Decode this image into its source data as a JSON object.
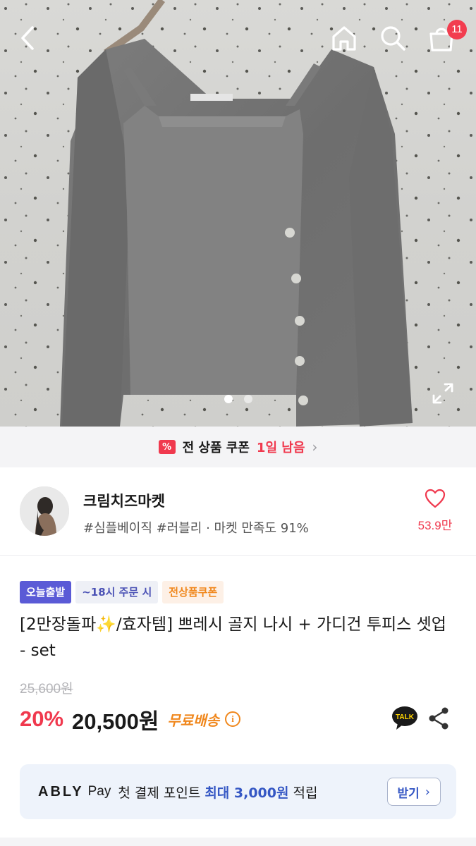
{
  "header": {
    "back_icon": "chevron-left-icon",
    "home_icon": "home-icon",
    "search_icon": "search-icon",
    "cart_icon": "shopping-bag-icon",
    "cart_count": "11"
  },
  "gallery": {
    "current_index": 1,
    "total": 2,
    "expand_icon": "expand-icon"
  },
  "coupon_banner": {
    "icon": "%",
    "text": "전 상품 쿠폰",
    "remaining": "1일 남음"
  },
  "seller": {
    "name": "크림치즈마켓",
    "tags": "#심플베이직 #러블리 · 마켓 만족도 91%",
    "like_count": "53.9만"
  },
  "product": {
    "badges": [
      "오늘출발",
      "~18시 주문 시",
      "전상품쿠폰"
    ],
    "title": "[2만장돌파✨/효자템] 쁘레시 골지 나시 + 가디건 투피스 셋업 - set",
    "original_price": "25,600원",
    "discount": "20%",
    "price": "20,500원",
    "shipping": "무료배송",
    "talk_label": "TALK"
  },
  "pay_banner": {
    "logo": "ABLY",
    "logo_sub": "Pay",
    "text_prefix": "첫 결제 포인트",
    "highlight": "최대 3,000원",
    "text_suffix": "적립",
    "button_label": "받기"
  },
  "colors": {
    "accent_red": "#f0394e",
    "accent_orange": "#f0871c",
    "accent_blue": "#3557c4",
    "badge_purple": "#5a5ad6"
  }
}
